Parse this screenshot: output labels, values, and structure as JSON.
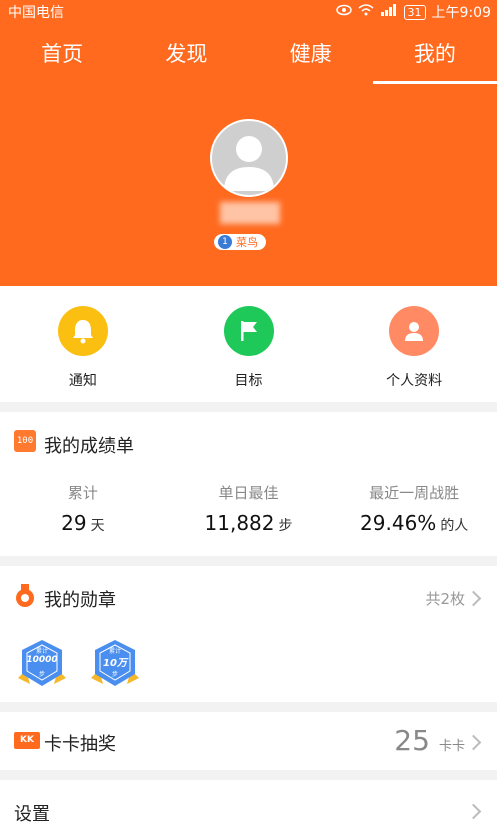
{
  "status_bar": {
    "carrier": "中国电信",
    "battery": "31",
    "time": "上午9:09"
  },
  "tabs": [
    "首页",
    "发现",
    "健康",
    "我的"
  ],
  "profile": {
    "level_label": "菜鸟"
  },
  "quick_actions": [
    {
      "label": "通知",
      "icon": "bell-icon",
      "color": "#fbbf12"
    },
    {
      "label": "目标",
      "icon": "flag-icon",
      "color": "#1ec95a"
    },
    {
      "label": "个人资料",
      "icon": "person-icon",
      "color": "#ff8a63"
    }
  ],
  "scores": {
    "title": "我的成绩单",
    "stats": [
      {
        "label": "累计",
        "value": "29",
        "unit": "天"
      },
      {
        "label": "单日最佳",
        "value": "11,882",
        "unit": "步"
      },
      {
        "label": "最近一周战胜",
        "value": "29.46%",
        "unit": "的人"
      }
    ]
  },
  "medals": {
    "title": "我的勋章",
    "count": "共2枚",
    "badges": [
      {
        "line1": "累计",
        "line2": "10000",
        "line3": "步"
      },
      {
        "line1": "累计",
        "line2": "10万",
        "line3": "步"
      }
    ]
  },
  "lottery": {
    "title": "卡卡抽奖",
    "icon_text": "KK",
    "value": "25",
    "unit": "卡卡"
  },
  "settings": {
    "label": "设置"
  },
  "colors": {
    "brand": "#ff6a1f"
  }
}
